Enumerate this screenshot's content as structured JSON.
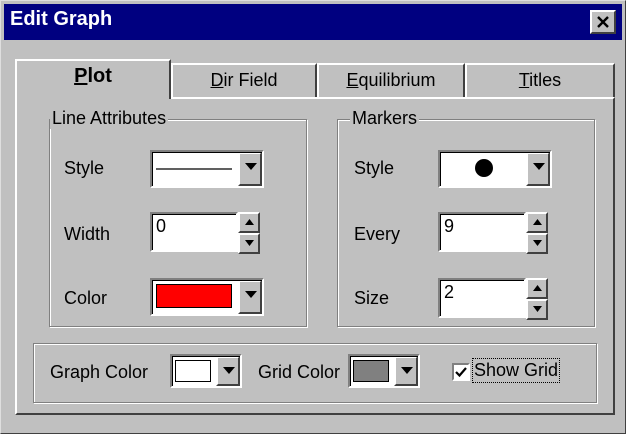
{
  "window": {
    "title": "Edit Graph",
    "close_glyph": "×"
  },
  "tabs": [
    {
      "mnemonic": "P",
      "rest": "lot",
      "active": true
    },
    {
      "mnemonic": "D",
      "rest": "ir Field",
      "active": false
    },
    {
      "mnemonic": "E",
      "rest": "quilibrium",
      "active": false
    },
    {
      "mnemonic": "T",
      "rest": "itles",
      "active": false
    }
  ],
  "line_attributes": {
    "legend": "Line Attributes",
    "style_label": "Style",
    "width_label": "Width",
    "width_value": "0",
    "color_label": "Color",
    "color_value": "#ff0000"
  },
  "markers": {
    "legend": "Markers",
    "style_label": "Style",
    "every_label": "Every",
    "every_value": "9",
    "size_label": "Size",
    "size_value": "2",
    "marker_shape": "filled-circle"
  },
  "bottom": {
    "graph_color_label": "Graph Color",
    "graph_color_value": "#ffffff",
    "grid_color_label": "Grid Color",
    "grid_color_value": "#808080",
    "show_grid_label": "Show Grid",
    "show_grid_checked": true
  },
  "colors": {
    "face": "#c0c0c0",
    "titlebar": "#000080"
  }
}
